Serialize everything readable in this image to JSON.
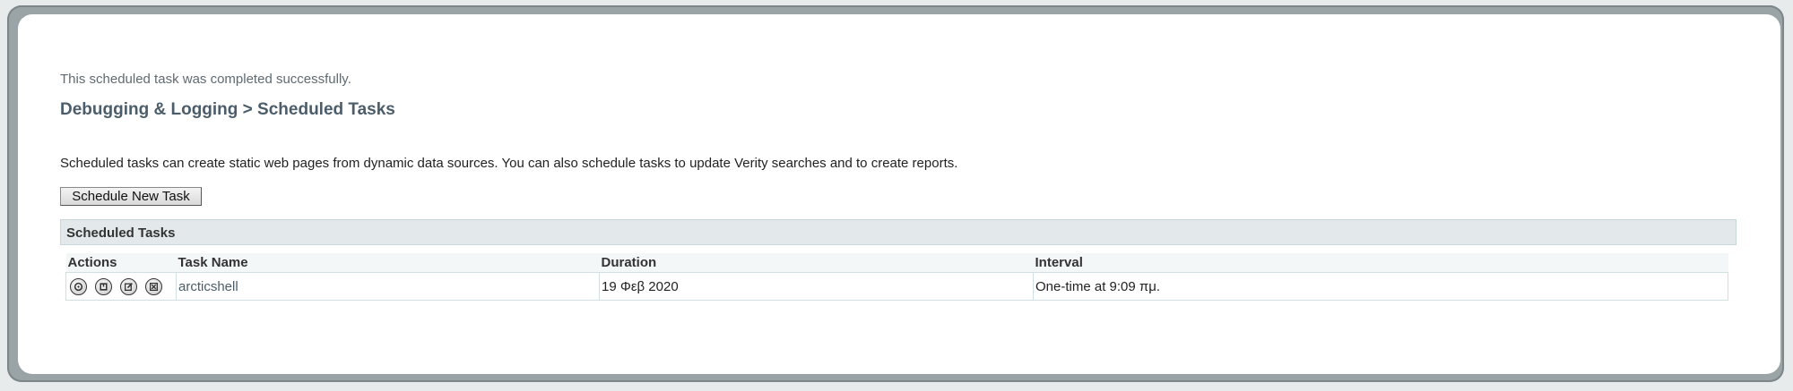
{
  "message": "This scheduled task was completed successfully.",
  "page_title": "Debugging & Logging > Scheduled Tasks",
  "description": "Scheduled tasks can create static web pages from dynamic data sources. You can also schedule tasks to update Verity searches and to create reports.",
  "new_task_button": "Schedule New Task",
  "section_title": "Scheduled Tasks",
  "table": {
    "headers": [
      "Actions",
      "Task Name",
      "Duration",
      "Interval"
    ],
    "rows": [
      {
        "actions": [
          "run-icon",
          "pause-icon",
          "edit-icon",
          "delete-icon"
        ],
        "task_name": "arcticshell",
        "duration": "19 Φεβ 2020",
        "interval": "One-time at 9:09 πμ."
      }
    ]
  }
}
